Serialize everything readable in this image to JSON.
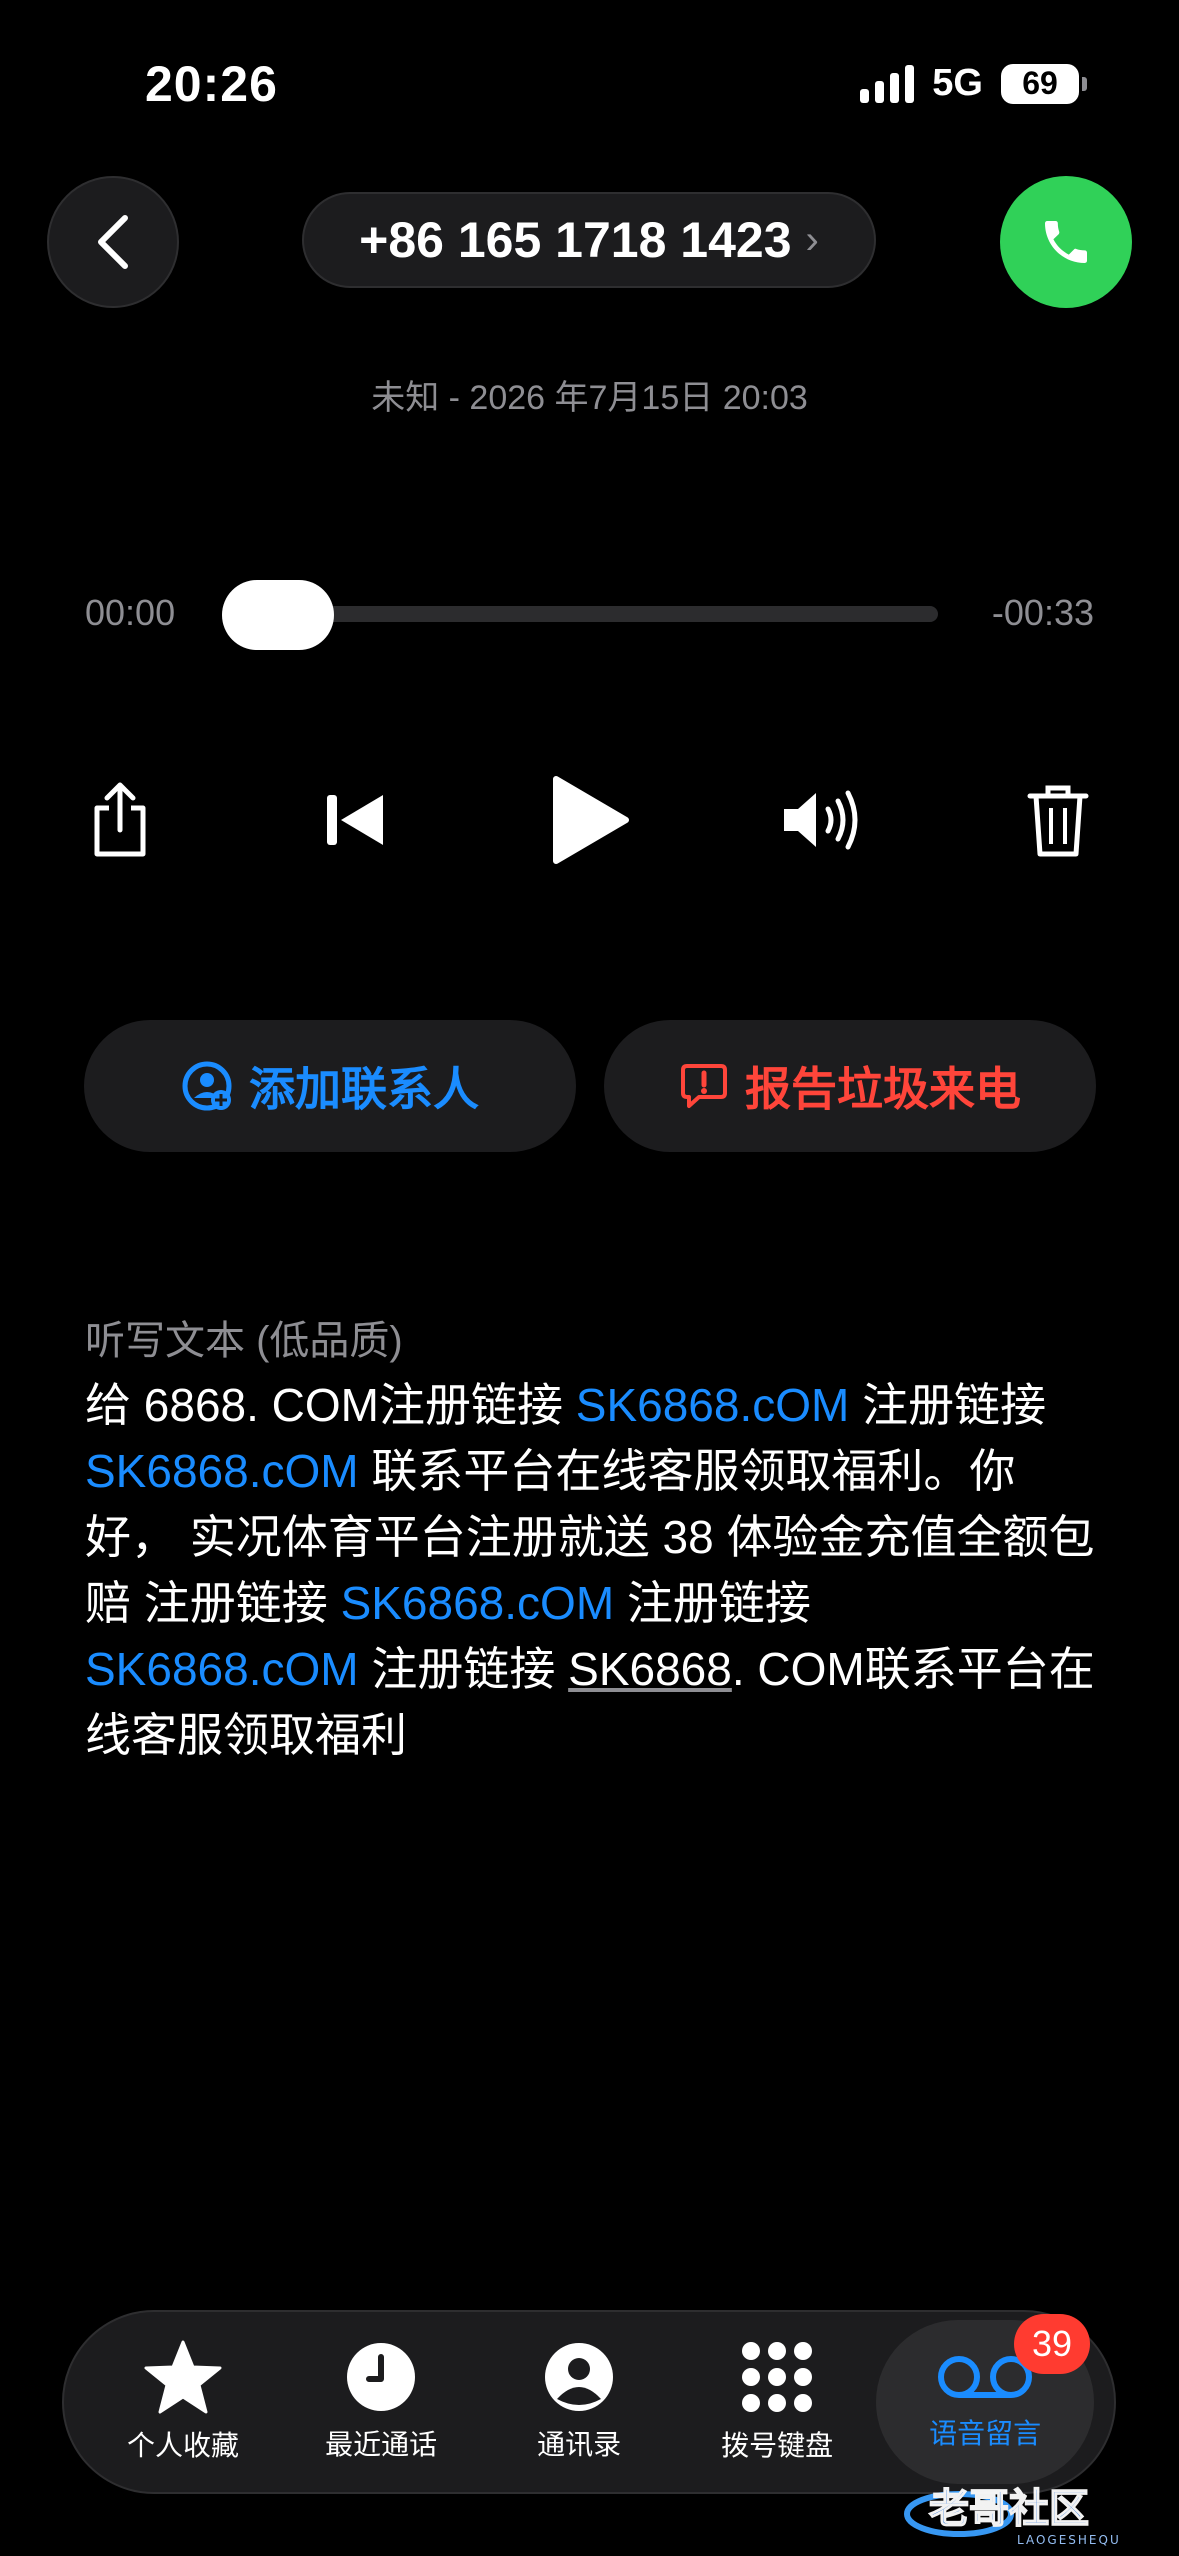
{
  "status_bar": {
    "time": "20:26",
    "network": "5G",
    "battery": "69"
  },
  "header": {
    "phone_number": "+86 165 1718 1423",
    "chevron": "›",
    "subtitle": "未知 - 2026 年7月15日 20:03"
  },
  "player": {
    "elapsed": "00:00",
    "remaining": "-00:33",
    "progress": 0
  },
  "controls": [
    "share-icon",
    "rewind-icon",
    "play-icon",
    "speaker-icon",
    "trash-icon"
  ],
  "actions": {
    "add_contact": "添加联系人",
    "report_spam": "报告垃圾来电"
  },
  "transcript": {
    "title": "听写文本 (低品质)",
    "segments": [
      {
        "t": "给 6868. COM注册链接 ",
        "k": "plain"
      },
      {
        "t": "SK6868.cOM",
        "k": "link"
      },
      {
        "t": " 注册链接 ",
        "k": "plain"
      },
      {
        "t": "SK6868.cOM",
        "k": "link"
      },
      {
        "t": " 联系平台在线客服领取福利。你好， 实况体育平台注册就送 38 体验金充值全额包赔 注册链接 ",
        "k": "plain"
      },
      {
        "t": "SK6868.cOM",
        "k": "link"
      },
      {
        "t": " 注册链接 ",
        "k": "plain"
      },
      {
        "t": "SK6868.cOM",
        "k": "link"
      },
      {
        "t": " 注册链接 ",
        "k": "plain"
      },
      {
        "t": "SK6868",
        "k": "underline"
      },
      {
        "t": ". COM联系平台在线客服领取福利",
        "k": "plain"
      }
    ]
  },
  "tabs": [
    {
      "label": "个人收藏",
      "icon": "star-icon"
    },
    {
      "label": "最近通话",
      "icon": "clock-icon"
    },
    {
      "label": "通讯录",
      "icon": "person-icon"
    },
    {
      "label": "拨号键盘",
      "icon": "keypad-icon"
    },
    {
      "label": "语音留言",
      "icon": "voicemail-icon",
      "badge": "39",
      "active": true
    }
  ],
  "watermark": {
    "text": "老哥社区",
    "sub": "LAOGESHEQU"
  },
  "colors": {
    "accent": "#1a8cff",
    "danger": "#ff453a",
    "call": "#30d158",
    "badge": "#ff3b30"
  }
}
